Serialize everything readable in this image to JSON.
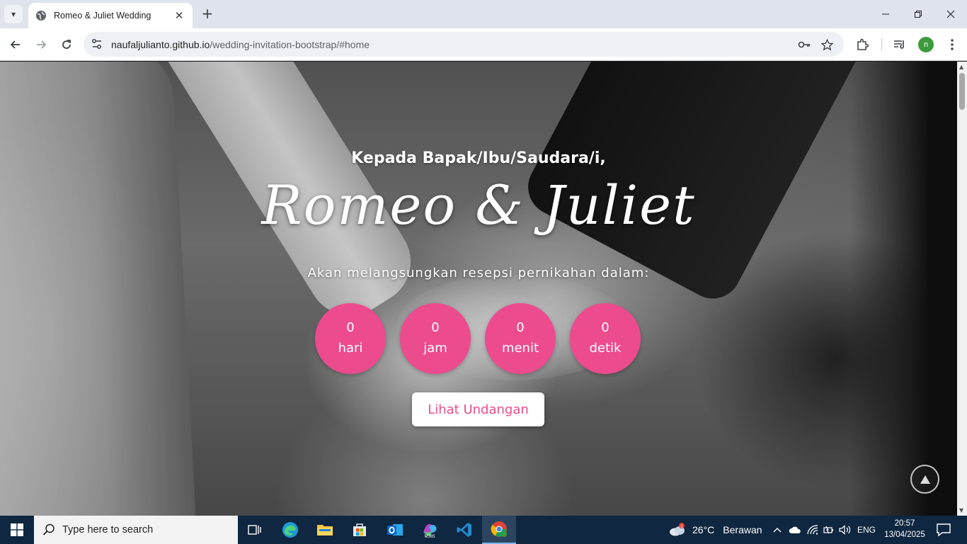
{
  "browser": {
    "tab_title": "Romeo & Juliet Wedding",
    "new_tab_symbol": "+",
    "url_domain": "naufaljulianto.github.io",
    "url_path": "/wedding-invitation-bootstrap/#home",
    "profile_initial": "n"
  },
  "page": {
    "greeting": "Kepada Bapak/Ibu/Saudara/i,",
    "couple_names": "Romeo & Juliet",
    "subtitle": "Akan melangsungkan resepsi pernikahan dalam:",
    "countdown": [
      {
        "value": "0",
        "unit": "hari"
      },
      {
        "value": "0",
        "unit": "jam"
      },
      {
        "value": "0",
        "unit": "menit"
      },
      {
        "value": "0",
        "unit": "detik"
      }
    ],
    "cta_label": "Lihat Undangan",
    "accent_color": "#ec4b8e"
  },
  "taskbar": {
    "search_placeholder": "Type here to search",
    "weather_temp": "26°C",
    "weather_desc": "Berawan",
    "weather_badge": "1",
    "language": "ENG",
    "time": "20:57",
    "date": "13/04/2025",
    "pinned_apps": [
      "task-view-icon",
      "edge-icon",
      "file-explorer-icon",
      "microsoft-store-icon",
      "outlook-icon",
      "m365-icon",
      "vscode-icon",
      "chrome-icon"
    ]
  }
}
